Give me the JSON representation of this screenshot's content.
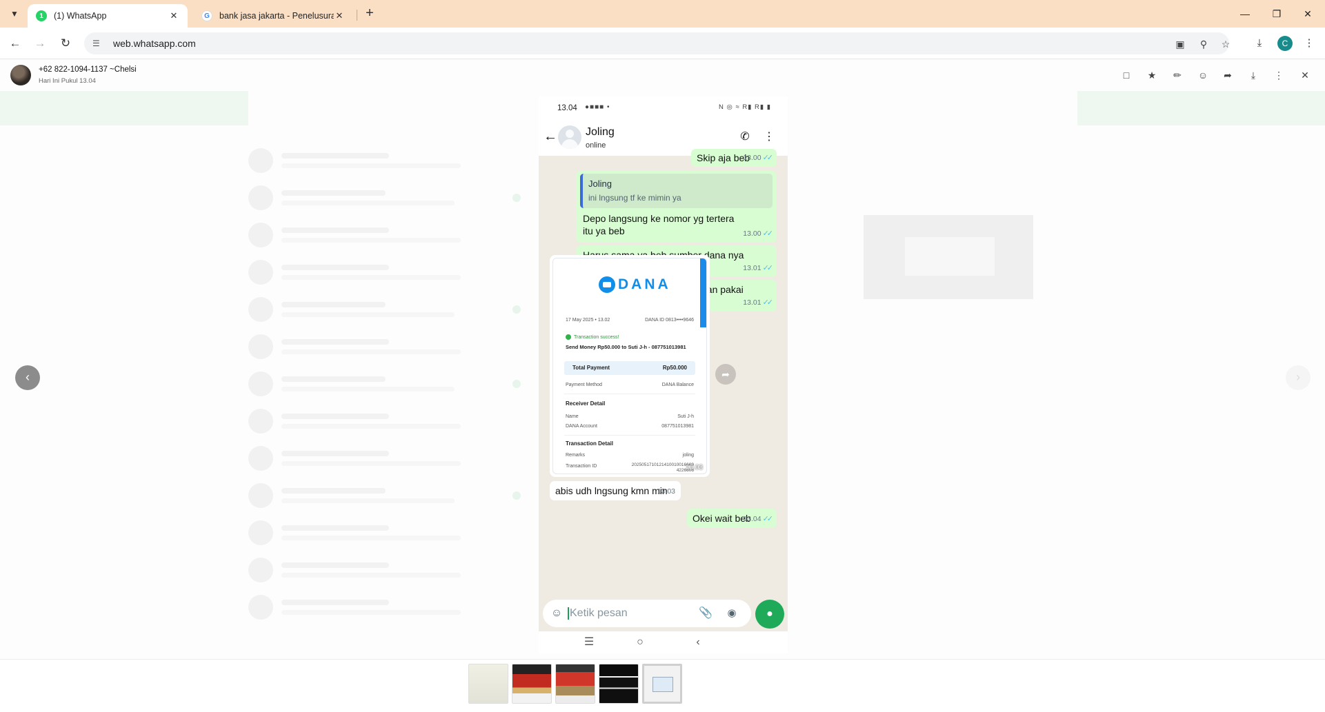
{
  "browser": {
    "tabs": [
      {
        "title": "(1) WhatsApp",
        "favicon_badge": "1",
        "active": true
      },
      {
        "title": "bank jasa jakarta - Penelusuran",
        "favicon_letter": "G",
        "active": false
      }
    ],
    "url": "web.whatsapp.com",
    "profile_initial": "C"
  },
  "viewer": {
    "sender_name": "+62 822-1094-1137 ~Chelsi",
    "sender_time": "Hari Ini Pukul 13.04"
  },
  "phone": {
    "status_time": "13.04",
    "contact_name": "Joling",
    "contact_status": "online",
    "messages": [
      {
        "text": "Skip aja beb",
        "time": "13.00",
        "dir": "out"
      },
      {
        "quote_name": "Joling",
        "quote_text": "ini lngsung tf ke mimin ya",
        "text": "Depo langsung ke nomor yg tertera itu ya beb",
        "time": "13.00",
        "dir": "out"
      },
      {
        "text": "Harus sama ya beb sumber dana nya yg untuk depo",
        "time": "13.01",
        "dir": "out"
      },
      {
        "text": "Harus tf dri dana beb ya jangan pakai rek lain",
        "time": "13.01",
        "dir": "out"
      },
      {
        "text": "abis udh lngsung kmn min",
        "time": "13.03",
        "dir": "in"
      },
      {
        "text": "Okei wait beb",
        "time": "13.04",
        "dir": "out"
      }
    ],
    "image_time": "13.03",
    "receipt": {
      "brand": "DANA",
      "date": "17 May 2025 • 13.02",
      "dana_id": "DANA ID 0813••••9646",
      "status": "Transaction success!",
      "headline": "Send Money Rp50.000 to Suti J-h - 087751013981",
      "total_label": "Total Payment",
      "total_value": "Rp50.000",
      "method_label": "Payment Method",
      "method_value": "DANA Balance",
      "receiver_title": "Receiver Detail",
      "name_label": "Name",
      "name_value": "Suti J-h",
      "account_label": "DANA Account",
      "account_value": "087751013981",
      "txn_title": "Transaction Detail",
      "remarks_label": "Remarks",
      "remarks_value": "joling",
      "txn_id_label": "Transaction ID",
      "txn_id_value": "20250517101214100100166694226606"
    },
    "input_placeholder": "Ketik pesan"
  },
  "colors": {
    "tabbar": "#fbdfc4",
    "outgoing_bubble": "#d9fdd3",
    "chat_bg": "#efeae2",
    "mic_button": "#1faa59",
    "dana_blue": "#118eea"
  }
}
